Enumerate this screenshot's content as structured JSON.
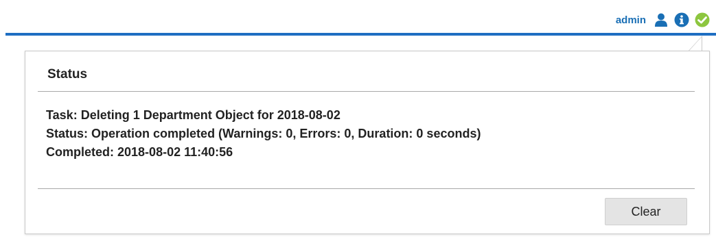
{
  "topbar": {
    "username": "admin",
    "icons": [
      "user-icon",
      "info-icon",
      "status-ok-icon"
    ],
    "accent_color": "#1e6ec2",
    "ok_color": "#8dc63f"
  },
  "status_panel": {
    "title": "Status",
    "task_label": "Task:",
    "task_value": "Deleting 1 Department Object for 2018-08-02",
    "status_label": "Status:",
    "status_value": "Operation completed (Warnings: 0, Errors: 0, Duration: 0 seconds)",
    "completed_label": "Completed:",
    "completed_value": "2018-08-02 11:40:56",
    "clear_label": "Clear"
  }
}
